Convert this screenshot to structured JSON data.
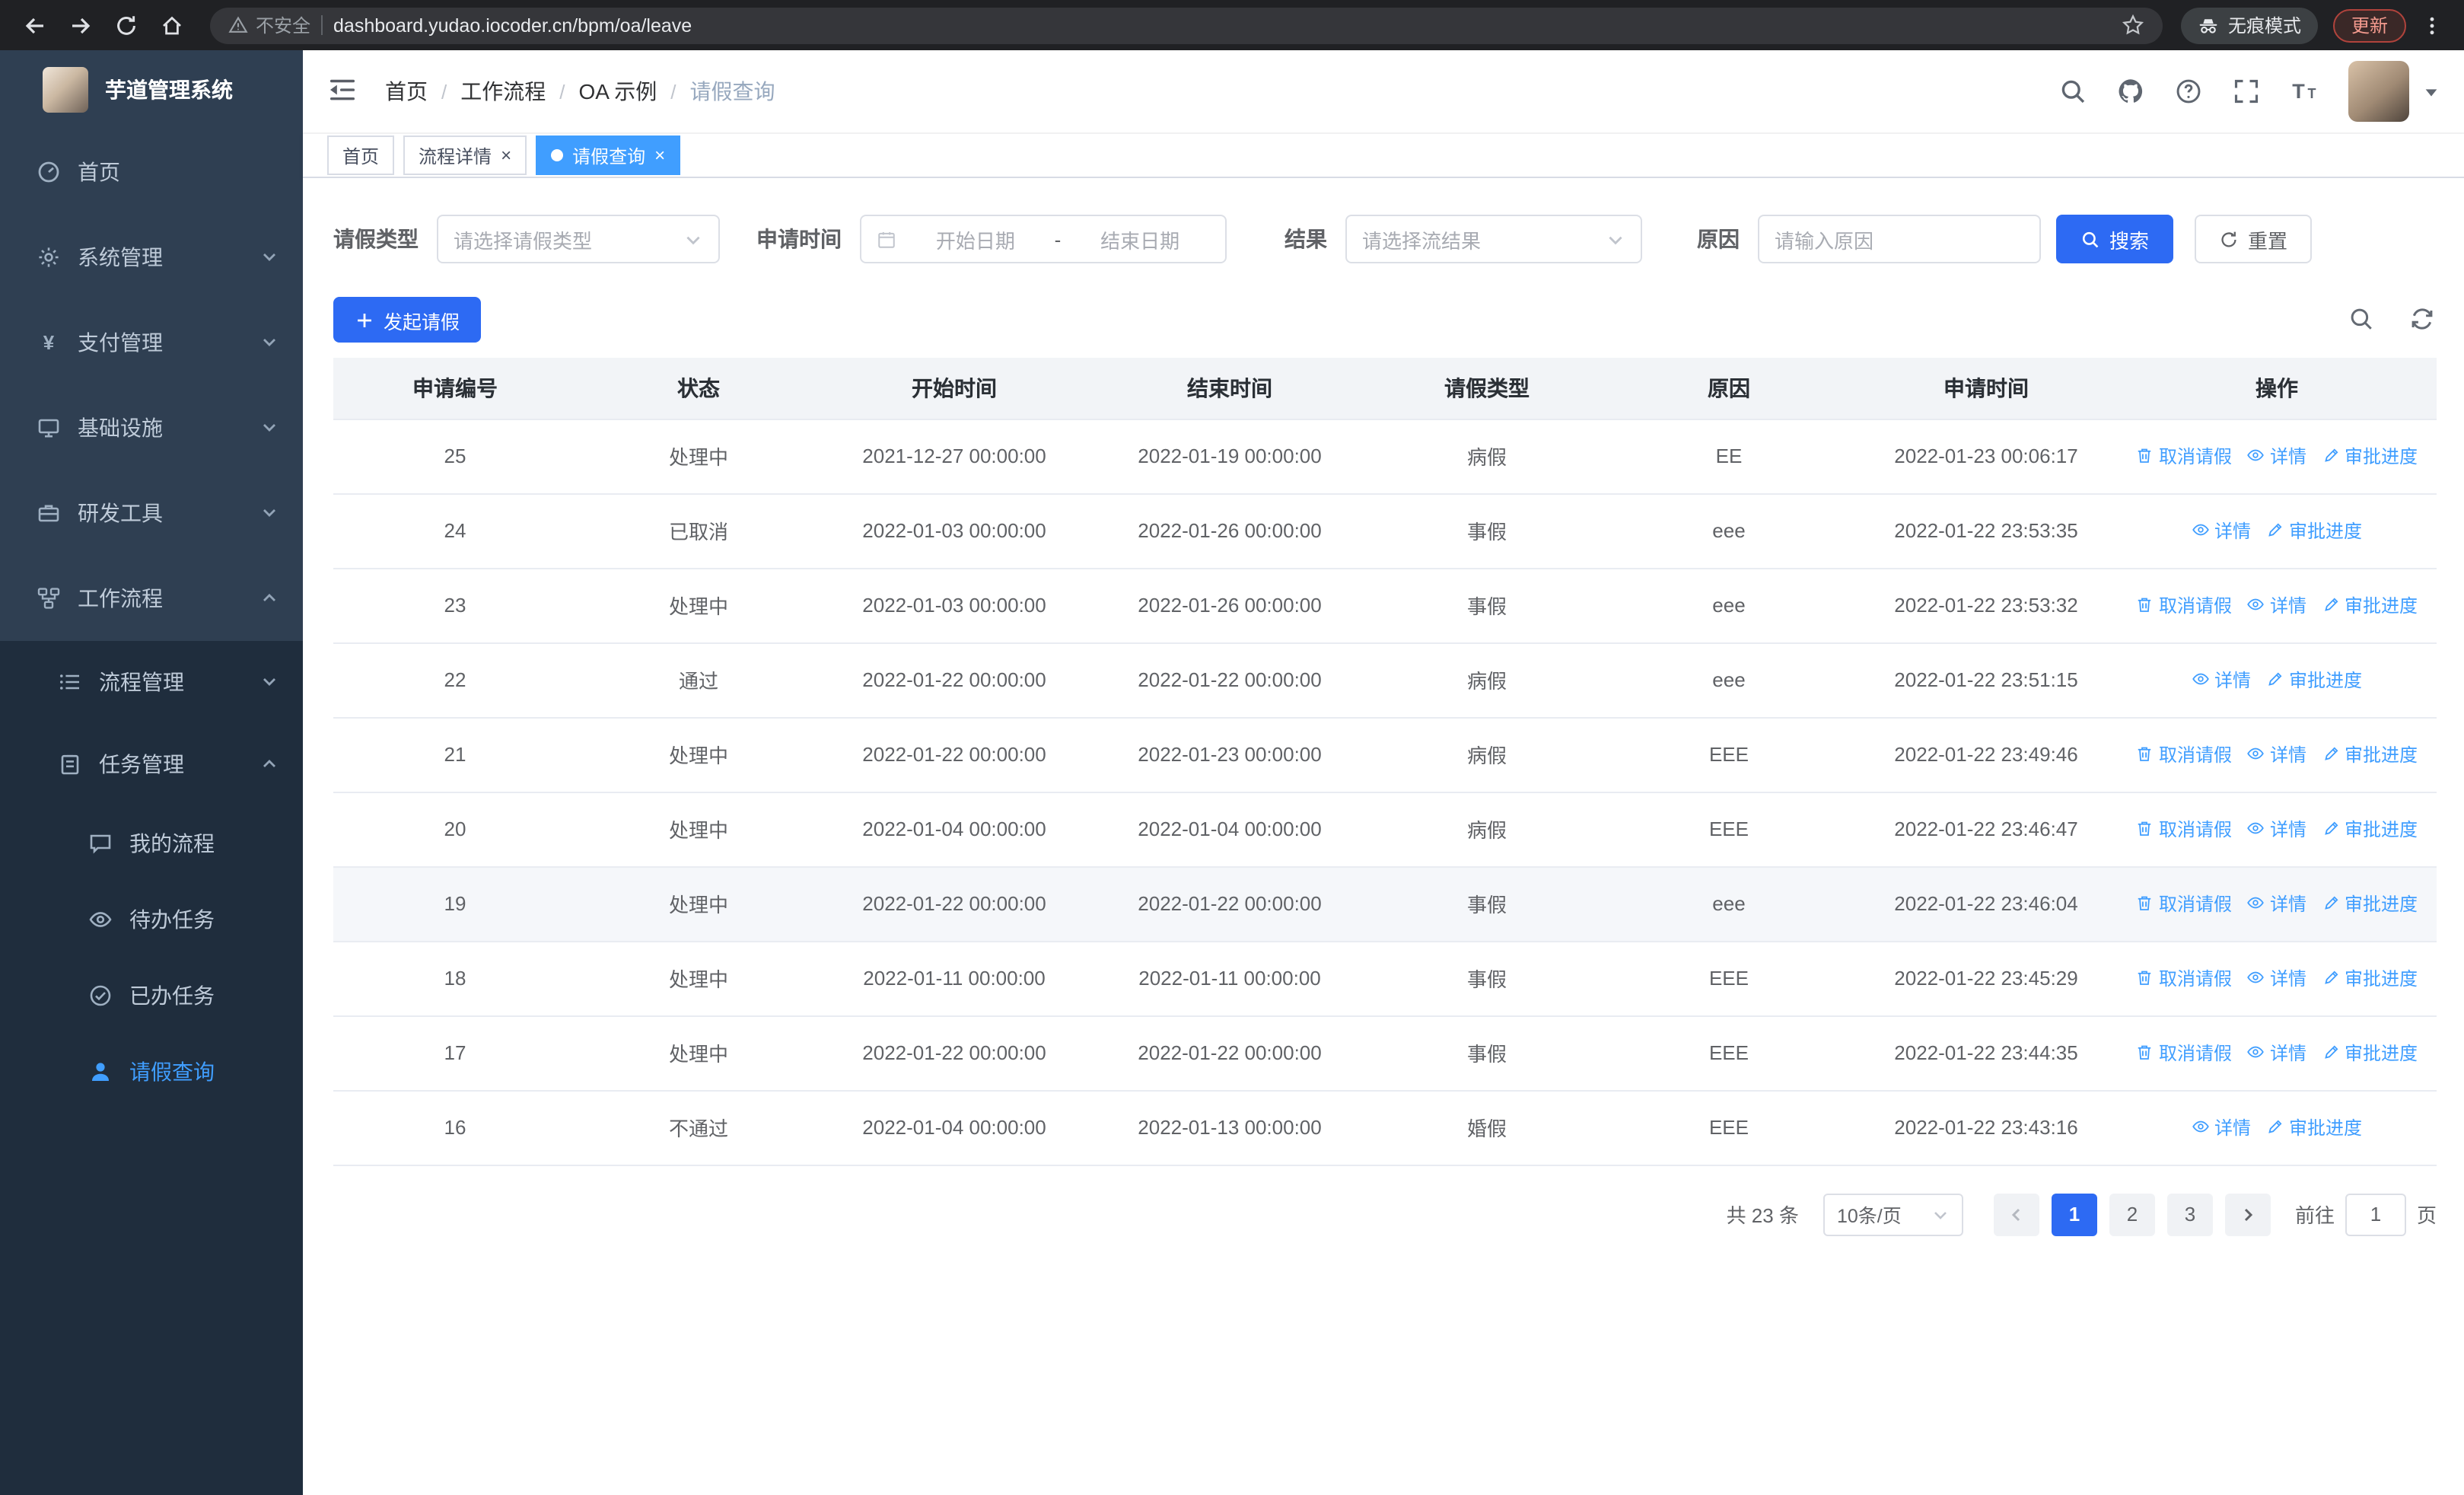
{
  "browser": {
    "security_label": "不安全",
    "url": "dashboard.yudao.iocoder.cn/bpm/oa/leave",
    "incognito_label": "无痕模式",
    "update_label": "更新"
  },
  "sidebar": {
    "logo_title": "芋道管理系统",
    "items": [
      {
        "label": "首页"
      },
      {
        "label": "系统管理"
      },
      {
        "label": "支付管理"
      },
      {
        "label": "基础设施"
      },
      {
        "label": "研发工具"
      },
      {
        "label": "工作流程"
      }
    ],
    "sub_items": [
      {
        "label": "流程管理"
      },
      {
        "label": "任务管理"
      }
    ],
    "leaf_items": [
      {
        "label": "我的流程"
      },
      {
        "label": "待办任务"
      },
      {
        "label": "已办任务"
      },
      {
        "label": "请假查询"
      }
    ]
  },
  "header": {
    "breadcrumb": [
      "首页",
      "工作流程",
      "OA 示例",
      "请假查询"
    ]
  },
  "tabs": [
    {
      "label": "首页"
    },
    {
      "label": "流程详情"
    },
    {
      "label": "请假查询"
    }
  ],
  "filters": {
    "leave_type_label": "请假类型",
    "leave_type_placeholder": "请选择请假类型",
    "apply_time_label": "申请时间",
    "start_date_placeholder": "开始日期",
    "range_separator": "-",
    "end_date_placeholder": "结束日期",
    "result_label": "结果",
    "result_placeholder": "请选择流结果",
    "reason_label": "原因",
    "reason_placeholder": "请输入原因",
    "search_button": "搜索",
    "reset_button": "重置"
  },
  "toolbar": {
    "create_button": "发起请假"
  },
  "table": {
    "columns": [
      "申请编号",
      "状态",
      "开始时间",
      "结束时间",
      "请假类型",
      "原因",
      "申请时间",
      "操作"
    ],
    "actions": {
      "cancel": "取消请假",
      "detail": "详情",
      "progress": "审批进度"
    },
    "rows": [
      {
        "id": "25",
        "status": "处理中",
        "start": "2021-12-27 00:00:00",
        "end": "2022-01-19 00:00:00",
        "type": "病假",
        "reason": "EE",
        "applied": "2022-01-23 00:06:17",
        "cancellable": true,
        "highlighted": false
      },
      {
        "id": "24",
        "status": "已取消",
        "start": "2022-01-03 00:00:00",
        "end": "2022-01-26 00:00:00",
        "type": "事假",
        "reason": "eee",
        "applied": "2022-01-22 23:53:35",
        "cancellable": false,
        "highlighted": false
      },
      {
        "id": "23",
        "status": "处理中",
        "start": "2022-01-03 00:00:00",
        "end": "2022-01-26 00:00:00",
        "type": "事假",
        "reason": "eee",
        "applied": "2022-01-22 23:53:32",
        "cancellable": true,
        "highlighted": false
      },
      {
        "id": "22",
        "status": "通过",
        "start": "2022-01-22 00:00:00",
        "end": "2022-01-22 00:00:00",
        "type": "病假",
        "reason": "eee",
        "applied": "2022-01-22 23:51:15",
        "cancellable": false,
        "highlighted": false
      },
      {
        "id": "21",
        "status": "处理中",
        "start": "2022-01-22 00:00:00",
        "end": "2022-01-23 00:00:00",
        "type": "病假",
        "reason": "EEE",
        "applied": "2022-01-22 23:49:46",
        "cancellable": true,
        "highlighted": false
      },
      {
        "id": "20",
        "status": "处理中",
        "start": "2022-01-04 00:00:00",
        "end": "2022-01-04 00:00:00",
        "type": "病假",
        "reason": "EEE",
        "applied": "2022-01-22 23:46:47",
        "cancellable": true,
        "highlighted": false
      },
      {
        "id": "19",
        "status": "处理中",
        "start": "2022-01-22 00:00:00",
        "end": "2022-01-22 00:00:00",
        "type": "事假",
        "reason": "eee",
        "applied": "2022-01-22 23:46:04",
        "cancellable": true,
        "highlighted": true
      },
      {
        "id": "18",
        "status": "处理中",
        "start": "2022-01-11 00:00:00",
        "end": "2022-01-11 00:00:00",
        "type": "事假",
        "reason": "EEE",
        "applied": "2022-01-22 23:45:29",
        "cancellable": true,
        "highlighted": false
      },
      {
        "id": "17",
        "status": "处理中",
        "start": "2022-01-22 00:00:00",
        "end": "2022-01-22 00:00:00",
        "type": "事假",
        "reason": "EEE",
        "applied": "2022-01-22 23:44:35",
        "cancellable": true,
        "highlighted": false
      },
      {
        "id": "16",
        "status": "不通过",
        "start": "2022-01-04 00:00:00",
        "end": "2022-01-13 00:00:00",
        "type": "婚假",
        "reason": "EEE",
        "applied": "2022-01-22 23:43:16",
        "cancellable": false,
        "highlighted": false
      }
    ]
  },
  "pagination": {
    "total_text": "共 23 条",
    "page_size": "10条/页",
    "pages": [
      "1",
      "2",
      "3"
    ],
    "active_page": "1",
    "goto_label": "前往",
    "goto_value": "1",
    "goto_suffix": "页"
  },
  "colors": {
    "primary": "#2d6af3",
    "link": "#409eff",
    "sidebar_bg": "#2f3f52",
    "submenu_bg": "#1f2d3d"
  }
}
